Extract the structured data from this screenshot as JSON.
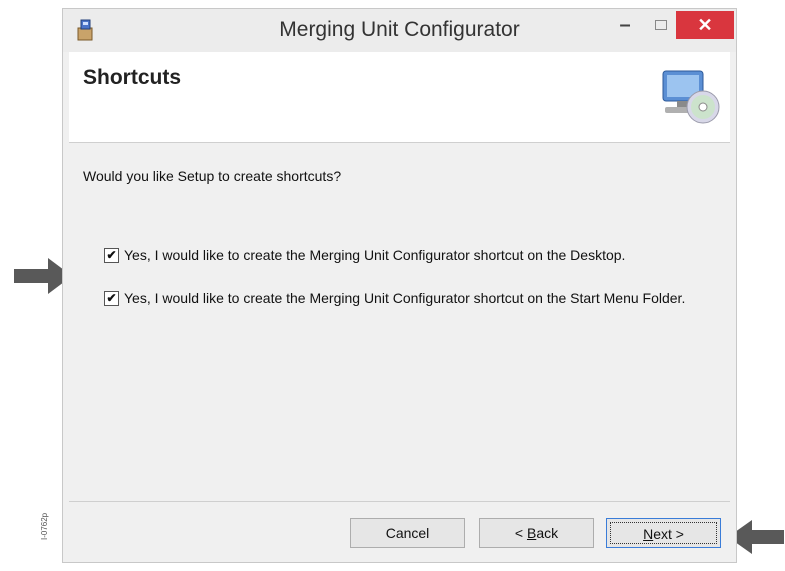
{
  "window": {
    "title": "Merging Unit Configurator"
  },
  "header": {
    "title": "Shortcuts"
  },
  "content": {
    "question": "Would you like Setup to create shortcuts?",
    "options": [
      {
        "label": "Yes, I would like to create the Merging Unit Configurator shortcut on the Desktop.",
        "checked": true
      },
      {
        "label": "Yes, I would like to create the Merging Unit Configurator shortcut on the Start Menu Folder.",
        "checked": true
      }
    ]
  },
  "buttons": {
    "cancel": "Cancel",
    "back_prefix": "< ",
    "back_key": "B",
    "back_rest": "ack",
    "next_key": "N",
    "next_rest": "ext >"
  },
  "figure_id": "I-0762p",
  "icons": {
    "app": "installer-icon",
    "setup": "computer-cd-icon",
    "pointer": "arrow-pointer-icon"
  },
  "colors": {
    "close_button": "#d9363e",
    "focus_border": "#3a7cd8",
    "arrow": "#595959"
  }
}
